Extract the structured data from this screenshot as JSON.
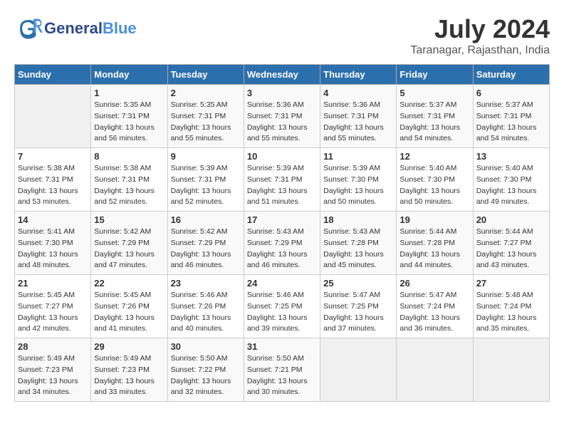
{
  "header": {
    "logo_general": "General",
    "logo_blue": "Blue",
    "month_year": "July 2024",
    "location": "Taranagar, Rajasthan, India"
  },
  "days_of_week": [
    "Sunday",
    "Monday",
    "Tuesday",
    "Wednesday",
    "Thursday",
    "Friday",
    "Saturday"
  ],
  "weeks": [
    [
      {
        "day": "",
        "sunrise": "",
        "sunset": "",
        "daylight": "",
        "empty": true
      },
      {
        "day": "1",
        "sunrise": "Sunrise: 5:35 AM",
        "sunset": "Sunset: 7:31 PM",
        "daylight": "Daylight: 13 hours and 56 minutes."
      },
      {
        "day": "2",
        "sunrise": "Sunrise: 5:35 AM",
        "sunset": "Sunset: 7:31 PM",
        "daylight": "Daylight: 13 hours and 55 minutes."
      },
      {
        "day": "3",
        "sunrise": "Sunrise: 5:36 AM",
        "sunset": "Sunset: 7:31 PM",
        "daylight": "Daylight: 13 hours and 55 minutes."
      },
      {
        "day": "4",
        "sunrise": "Sunrise: 5:36 AM",
        "sunset": "Sunset: 7:31 PM",
        "daylight": "Daylight: 13 hours and 55 minutes."
      },
      {
        "day": "5",
        "sunrise": "Sunrise: 5:37 AM",
        "sunset": "Sunset: 7:31 PM",
        "daylight": "Daylight: 13 hours and 54 minutes."
      },
      {
        "day": "6",
        "sunrise": "Sunrise: 5:37 AM",
        "sunset": "Sunset: 7:31 PM",
        "daylight": "Daylight: 13 hours and 54 minutes."
      }
    ],
    [
      {
        "day": "7",
        "sunrise": "Sunrise: 5:38 AM",
        "sunset": "Sunset: 7:31 PM",
        "daylight": "Daylight: 13 hours and 53 minutes."
      },
      {
        "day": "8",
        "sunrise": "Sunrise: 5:38 AM",
        "sunset": "Sunset: 7:31 PM",
        "daylight": "Daylight: 13 hours and 52 minutes."
      },
      {
        "day": "9",
        "sunrise": "Sunrise: 5:39 AM",
        "sunset": "Sunset: 7:31 PM",
        "daylight": "Daylight: 13 hours and 52 minutes."
      },
      {
        "day": "10",
        "sunrise": "Sunrise: 5:39 AM",
        "sunset": "Sunset: 7:31 PM",
        "daylight": "Daylight: 13 hours and 51 minutes."
      },
      {
        "day": "11",
        "sunrise": "Sunrise: 5:39 AM",
        "sunset": "Sunset: 7:30 PM",
        "daylight": "Daylight: 13 hours and 50 minutes."
      },
      {
        "day": "12",
        "sunrise": "Sunrise: 5:40 AM",
        "sunset": "Sunset: 7:30 PM",
        "daylight": "Daylight: 13 hours and 50 minutes."
      },
      {
        "day": "13",
        "sunrise": "Sunrise: 5:40 AM",
        "sunset": "Sunset: 7:30 PM",
        "daylight": "Daylight: 13 hours and 49 minutes."
      }
    ],
    [
      {
        "day": "14",
        "sunrise": "Sunrise: 5:41 AM",
        "sunset": "Sunset: 7:30 PM",
        "daylight": "Daylight: 13 hours and 48 minutes."
      },
      {
        "day": "15",
        "sunrise": "Sunrise: 5:42 AM",
        "sunset": "Sunset: 7:29 PM",
        "daylight": "Daylight: 13 hours and 47 minutes."
      },
      {
        "day": "16",
        "sunrise": "Sunrise: 5:42 AM",
        "sunset": "Sunset: 7:29 PM",
        "daylight": "Daylight: 13 hours and 46 minutes."
      },
      {
        "day": "17",
        "sunrise": "Sunrise: 5:43 AM",
        "sunset": "Sunset: 7:29 PM",
        "daylight": "Daylight: 13 hours and 46 minutes."
      },
      {
        "day": "18",
        "sunrise": "Sunrise: 5:43 AM",
        "sunset": "Sunset: 7:28 PM",
        "daylight": "Daylight: 13 hours and 45 minutes."
      },
      {
        "day": "19",
        "sunrise": "Sunrise: 5:44 AM",
        "sunset": "Sunset: 7:28 PM",
        "daylight": "Daylight: 13 hours and 44 minutes."
      },
      {
        "day": "20",
        "sunrise": "Sunrise: 5:44 AM",
        "sunset": "Sunset: 7:27 PM",
        "daylight": "Daylight: 13 hours and 43 minutes."
      }
    ],
    [
      {
        "day": "21",
        "sunrise": "Sunrise: 5:45 AM",
        "sunset": "Sunset: 7:27 PM",
        "daylight": "Daylight: 13 hours and 42 minutes."
      },
      {
        "day": "22",
        "sunrise": "Sunrise: 5:45 AM",
        "sunset": "Sunset: 7:26 PM",
        "daylight": "Daylight: 13 hours and 41 minutes."
      },
      {
        "day": "23",
        "sunrise": "Sunrise: 5:46 AM",
        "sunset": "Sunset: 7:26 PM",
        "daylight": "Daylight: 13 hours and 40 minutes."
      },
      {
        "day": "24",
        "sunrise": "Sunrise: 5:46 AM",
        "sunset": "Sunset: 7:25 PM",
        "daylight": "Daylight: 13 hours and 39 minutes."
      },
      {
        "day": "25",
        "sunrise": "Sunrise: 5:47 AM",
        "sunset": "Sunset: 7:25 PM",
        "daylight": "Daylight: 13 hours and 37 minutes."
      },
      {
        "day": "26",
        "sunrise": "Sunrise: 5:47 AM",
        "sunset": "Sunset: 7:24 PM",
        "daylight": "Daylight: 13 hours and 36 minutes."
      },
      {
        "day": "27",
        "sunrise": "Sunrise: 5:48 AM",
        "sunset": "Sunset: 7:24 PM",
        "daylight": "Daylight: 13 hours and 35 minutes."
      }
    ],
    [
      {
        "day": "28",
        "sunrise": "Sunrise: 5:49 AM",
        "sunset": "Sunset: 7:23 PM",
        "daylight": "Daylight: 13 hours and 34 minutes."
      },
      {
        "day": "29",
        "sunrise": "Sunrise: 5:49 AM",
        "sunset": "Sunset: 7:23 PM",
        "daylight": "Daylight: 13 hours and 33 minutes."
      },
      {
        "day": "30",
        "sunrise": "Sunrise: 5:50 AM",
        "sunset": "Sunset: 7:22 PM",
        "daylight": "Daylight: 13 hours and 32 minutes."
      },
      {
        "day": "31",
        "sunrise": "Sunrise: 5:50 AM",
        "sunset": "Sunset: 7:21 PM",
        "daylight": "Daylight: 13 hours and 30 minutes."
      },
      {
        "day": "",
        "sunrise": "",
        "sunset": "",
        "daylight": "",
        "empty": true
      },
      {
        "day": "",
        "sunrise": "",
        "sunset": "",
        "daylight": "",
        "empty": true
      },
      {
        "day": "",
        "sunrise": "",
        "sunset": "",
        "daylight": "",
        "empty": true
      }
    ]
  ]
}
